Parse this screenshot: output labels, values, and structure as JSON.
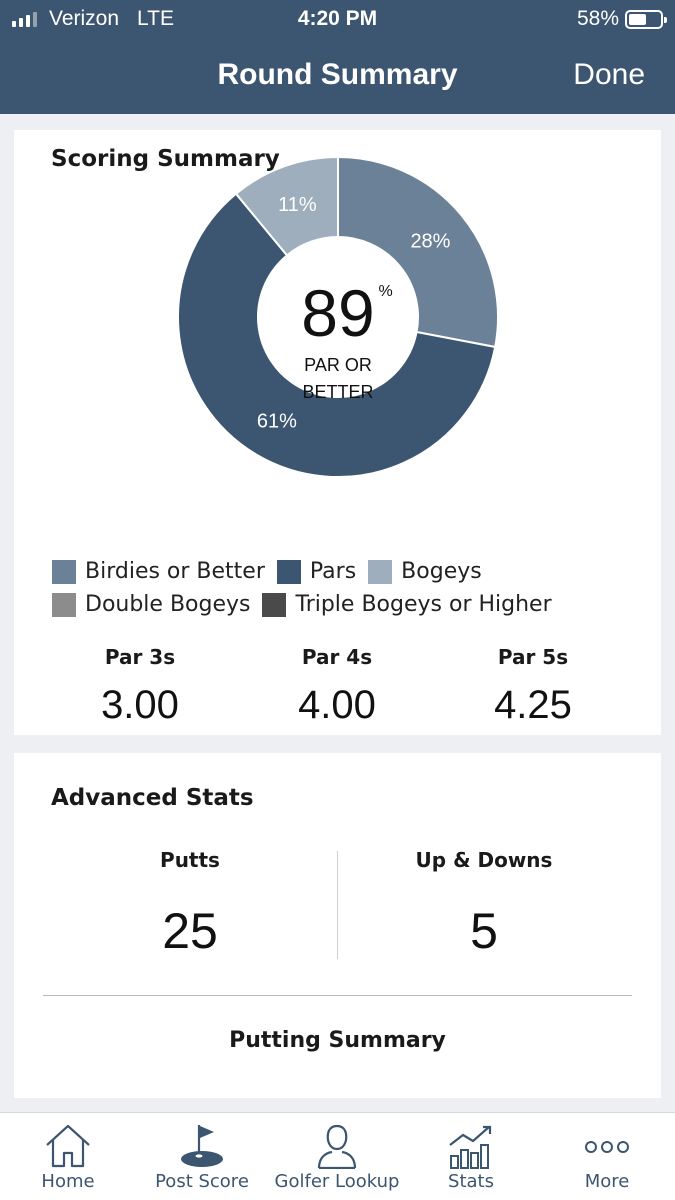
{
  "status_bar": {
    "carrier": "Verizon",
    "network": "LTE",
    "time": "4:20 PM",
    "battery": "58%",
    "battery_level": 0.58
  },
  "nav": {
    "title": "Round Summary",
    "done_label": "Done"
  },
  "scoring_summary": {
    "title": "Scoring Summary",
    "center_value": "89",
    "center_unit": "%",
    "center_label_line1": "PAR OR",
    "center_label_line2": "BETTER",
    "legend": [
      {
        "label": "Birdies or Better",
        "color": "#6b8198"
      },
      {
        "label": "Pars",
        "color": "#3c5570"
      },
      {
        "label": "Bogeys",
        "color": "#9eaebd"
      },
      {
        "label": "Double Bogeys",
        "color": "#8c8c8c"
      },
      {
        "label": "Triple Bogeys or Higher",
        "color": "#4a4a4a"
      }
    ],
    "par_averages": [
      {
        "label": "Par 3s",
        "value": "3.00"
      },
      {
        "label": "Par 4s",
        "value": "4.00"
      },
      {
        "label": "Par 5s",
        "value": "4.25"
      }
    ]
  },
  "chart_data": {
    "type": "pie",
    "categories": [
      "Birdies or Better",
      "Pars",
      "Bogeys",
      "Double Bogeys",
      "Triple Bogeys or Higher"
    ],
    "values": [
      28,
      61,
      11,
      0,
      0
    ],
    "labels": [
      "28%",
      "61%",
      "11%",
      "",
      ""
    ],
    "colors": [
      "#6b8198",
      "#3c5570",
      "#9eaebd",
      "#8c8c8c",
      "#4a4a4a"
    ],
    "donut": true,
    "legend_position": "bottom"
  },
  "advanced_stats": {
    "title": "Advanced Stats",
    "putts_label": "Putts",
    "putts_value": "25",
    "updowns_label": "Up & Downs",
    "updowns_value": "5",
    "putting_summary_label": "Putting Summary"
  },
  "tabbar": {
    "items": [
      {
        "label": "Home",
        "icon": "home-icon"
      },
      {
        "label": "Post Score",
        "icon": "flag-icon"
      },
      {
        "label": "Golfer Lookup",
        "icon": "person-icon"
      },
      {
        "label": "Stats",
        "icon": "stats-icon"
      },
      {
        "label": "More",
        "icon": "more-icon"
      }
    ]
  }
}
